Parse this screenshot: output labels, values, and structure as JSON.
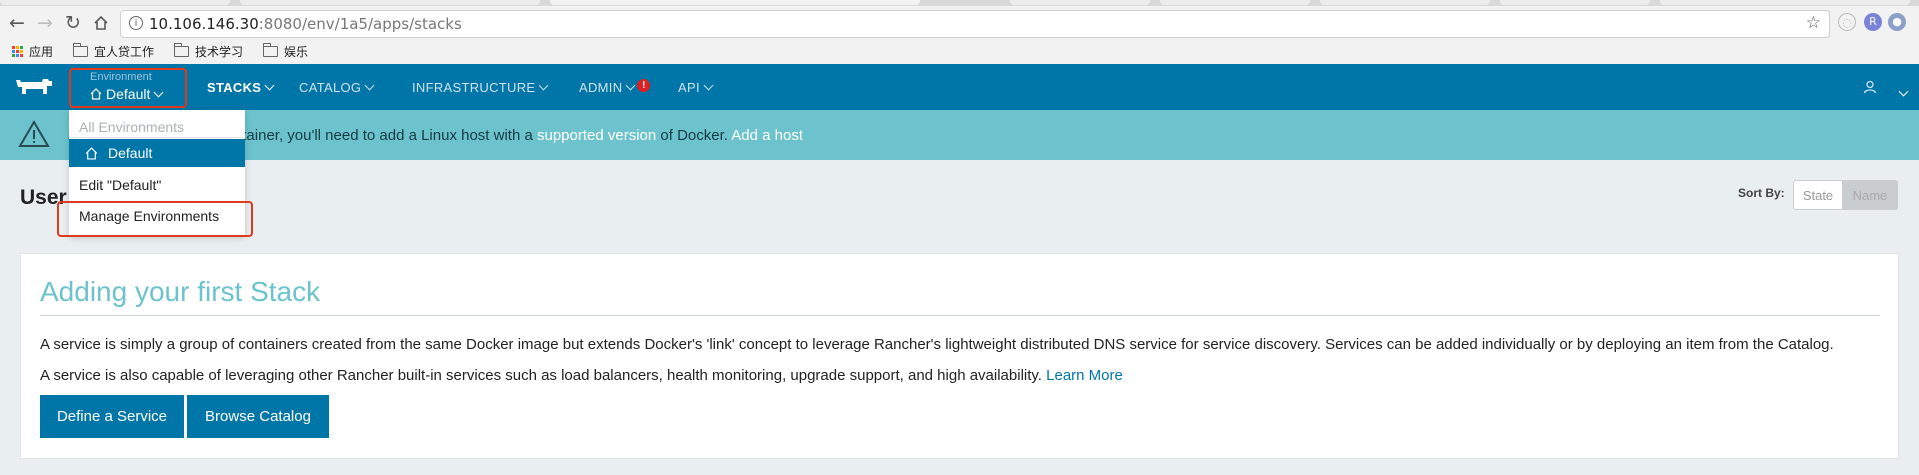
{
  "browser": {
    "url_host": "10.106.146.30",
    "url_rest": ":8080/env/1a5/apps/stacks",
    "bookmarks": [
      {
        "label": "应用",
        "icon": "apps-grid-icon"
      },
      {
        "label": "宜人贷工作",
        "icon": "folder-icon"
      },
      {
        "label": "技术学习",
        "icon": "folder-icon"
      },
      {
        "label": "娱乐",
        "icon": "folder-icon"
      }
    ]
  },
  "nav": {
    "environment_label": "Environment",
    "environment_value": "Default",
    "items": [
      "STACKS",
      "CATALOG",
      "INFRASTRUCTURE",
      "ADMIN",
      "API"
    ],
    "admin_badge": "!",
    "brand_color": "#0075a8"
  },
  "banner": {
    "text_before": "service or launching a container, you'll need to add a Linux host with a ",
    "link_supported": "supported version",
    "text_mid": " of Docker. ",
    "link_add_host": "Add a host",
    "color": "#6cc3cd"
  },
  "dropdown": {
    "all_environments": "All Environments",
    "default": "Default",
    "edit": "Edit \"Default\"",
    "manage": "Manage Environments"
  },
  "page": {
    "title": "User",
    "sort_label": "Sort By:",
    "sort_state": "State",
    "sort_name": "Name"
  },
  "card": {
    "heading": "Adding your first Stack",
    "p1": "A service is simply a group of containers created from the same Docker image but extends Docker's 'link' concept to leverage Rancher's lightweight distributed DNS service for service discovery. Services can be added individually or by deploying an item from the Catalog.",
    "p2": "A service is also capable of leveraging other Rancher built-in services such as load balancers, health monitoring, upgrade support, and high availability. ",
    "learn_more": "Learn More",
    "define_service": "Define a Service",
    "browse_catalog": "Browse Catalog"
  }
}
